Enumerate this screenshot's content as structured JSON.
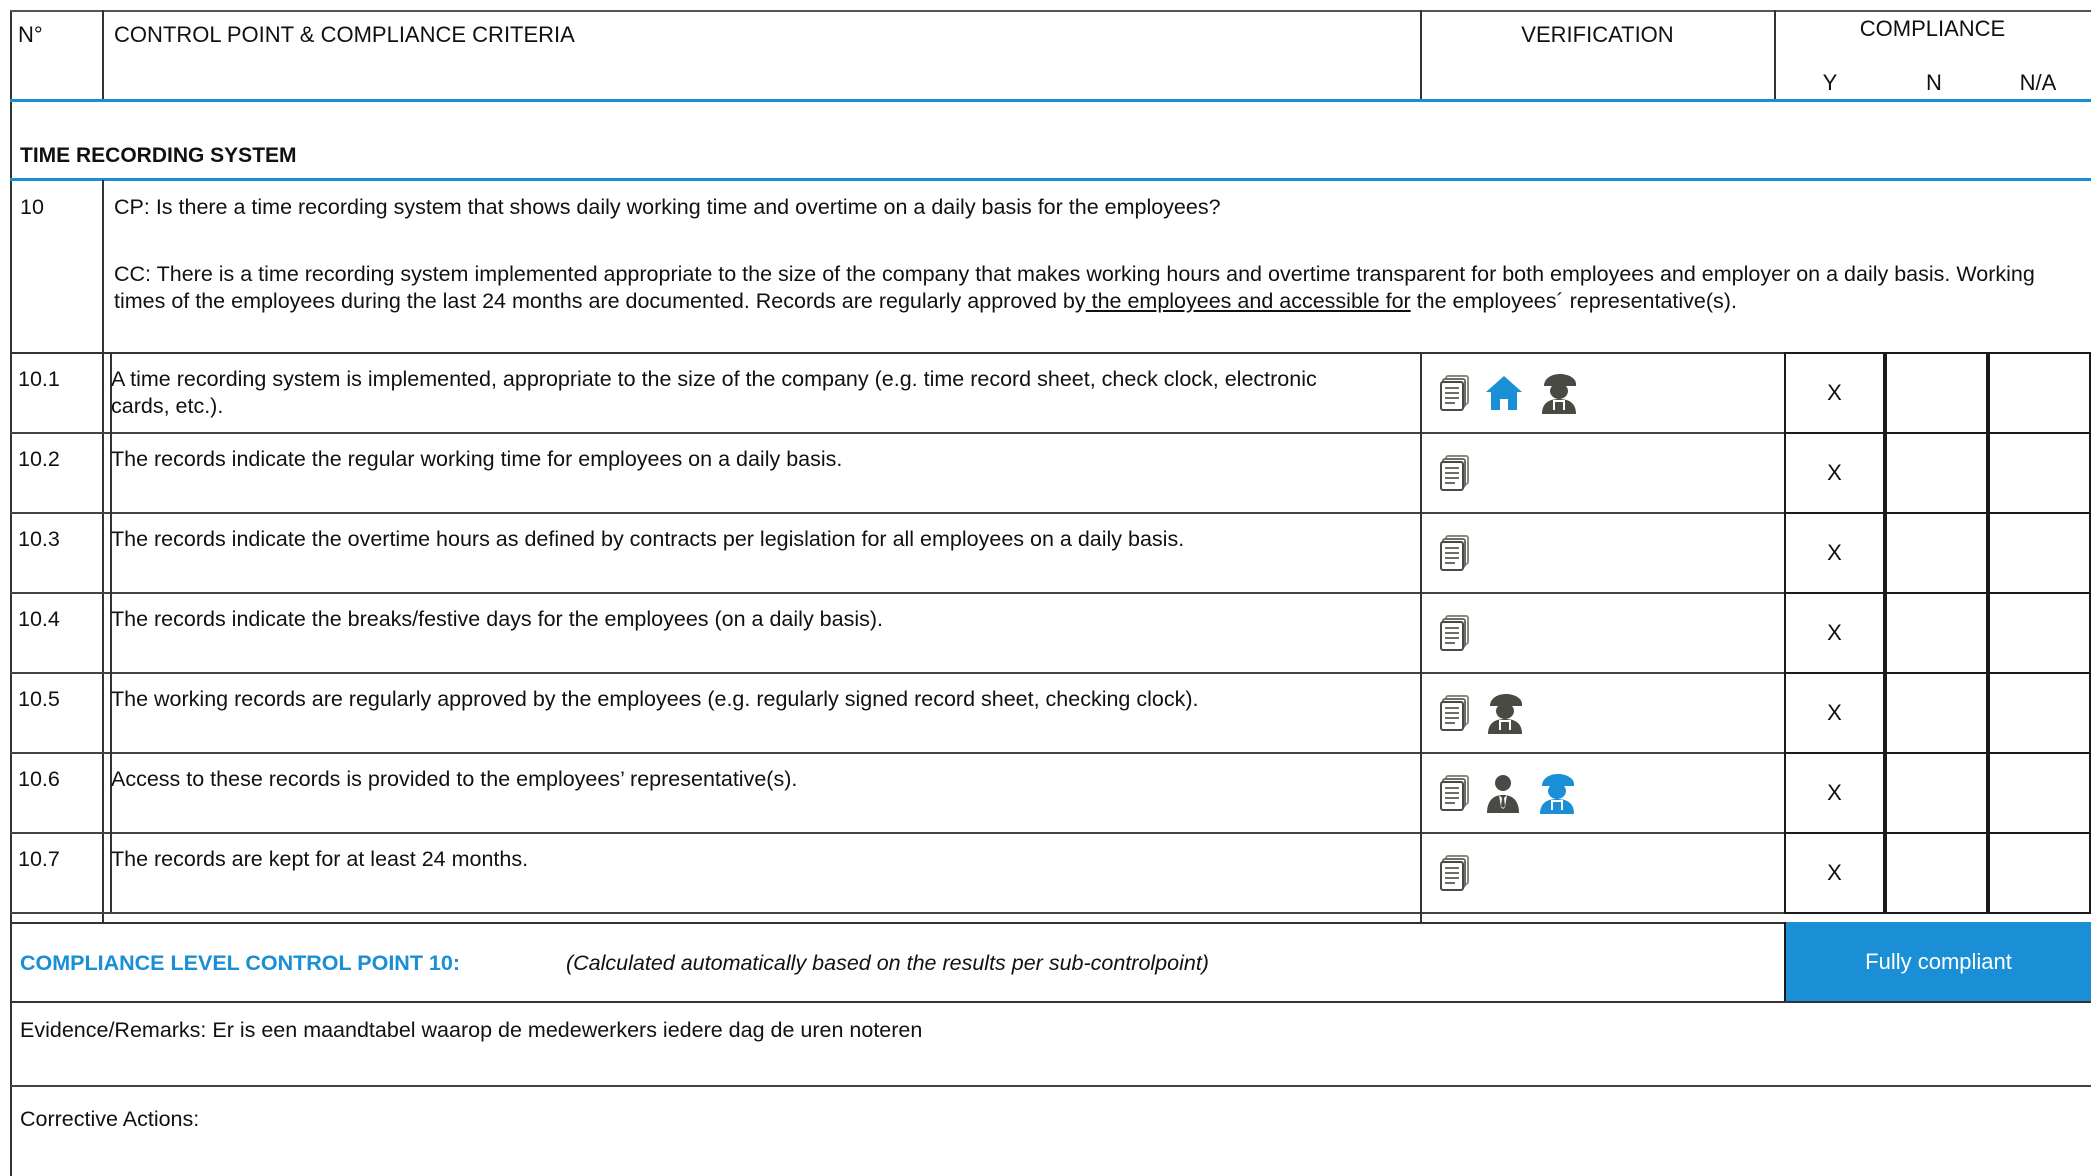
{
  "header": {
    "no": "N°",
    "criteria": "CONTROL POINT & COMPLIANCE CRITERIA",
    "verification": "VERIFICATION",
    "compliance": "COMPLIANCE",
    "y": "Y",
    "n": "N",
    "na": "N/A"
  },
  "section": {
    "title": "TIME RECORDING SYSTEM"
  },
  "control_point": {
    "number": "10",
    "cp": "CP: Is there a time recording system that shows daily working time and overtime on a daily basis for the employees?",
    "cc_part1": "CC: There is a time recording system implemented appropriate to the size of the company that makes working hours and overtime transparent for both employees and employer on a daily basis. Working times of the employees during the last 24 months are documented. Records are regularly approved by",
    "cc_underlined": " the employees and accessible for",
    "cc_part2": " the employees´ representative(s)."
  },
  "rows": [
    {
      "no": "10.1",
      "text": "A time recording system is implemented, appropriate to the size of the company (e.g. time record sheet, check clock, electronic cards, etc.).",
      "icons": [
        "document-icon",
        "home-icon",
        "worker-icon"
      ],
      "mark": "X"
    },
    {
      "no": "10.2",
      "text": "The records indicate the regular working time for employees on a daily basis.",
      "icons": [
        "document-icon"
      ],
      "mark": "X"
    },
    {
      "no": "10.3",
      "text": "The records indicate the overtime hours as defined by contracts per legislation for all employees on a daily basis.",
      "icons": [
        "document-icon"
      ],
      "mark": "X"
    },
    {
      "no": "10.4",
      "text": "The records indicate the breaks/festive days for the employees (on a daily basis).",
      "icons": [
        "document-icon"
      ],
      "mark": "X"
    },
    {
      "no": "10.5",
      "text": "The working records are regularly approved by the employees (e.g. regularly signed record sheet, checking clock).",
      "icons": [
        "document-icon",
        "worker-icon"
      ],
      "mark": "X"
    },
    {
      "no": "10.6",
      "text": "Access to these records is provided to the employees’ representative(s).",
      "icons": [
        "document-icon",
        "manager-icon",
        "worker-icon"
      ],
      "mark": "X"
    },
    {
      "no": "10.7",
      "text": "The records are kept for at least 24 months.",
      "icons": [
        "document-icon"
      ],
      "mark": "X"
    }
  ],
  "compliance_level": {
    "label": "COMPLIANCE LEVEL CONTROL POINT 10:",
    "note": "(Calculated automatically based on the results per sub-controlpoint)",
    "result": "Fully compliant"
  },
  "evidence": {
    "text": "Evidence/Remarks: Er is een maandtabel waarop de medewerkers iedere dag de uren noteren"
  },
  "corrective": {
    "text": "Corrective Actions:"
  },
  "colors": {
    "accent": "#1a8fd6",
    "icon_gray": "#4a4a44",
    "icon_blue": "#1a8fd6"
  }
}
